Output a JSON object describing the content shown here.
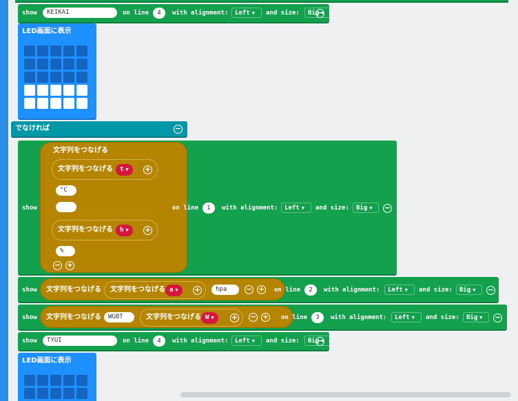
{
  "blocks": {
    "show1": {
      "keyword": "show",
      "text": "KEIKAI",
      "on_line": "on line",
      "line": "4",
      "with_alignment": "with alignment:",
      "alignment": "Left",
      "and_size": "and size:",
      "size": "Big"
    },
    "led1": {
      "label": "LED画面に表示",
      "pattern": [
        0,
        0,
        0,
        0,
        0,
        0,
        0,
        0,
        0,
        0,
        0,
        0,
        0,
        0,
        0,
        1,
        1,
        1,
        1,
        1,
        1,
        1,
        1,
        1,
        1
      ]
    },
    "else": {
      "label": "でなければ"
    },
    "show2": {
      "keyword": "show",
      "join_outer": "文字列をつなげる",
      "join_t": "文字列をつなげる",
      "var_t": "t",
      "str_c": "°C",
      "str_empty": "",
      "join_h": "文字列をつなげる",
      "var_h": "h",
      "str_pct": "%",
      "on_line": "on line",
      "line": "1",
      "with_alignment": "with alignment:",
      "alignment": "Left",
      "and_size": "and size:",
      "size": "Big"
    },
    "show3": {
      "keyword": "show",
      "join_outer": "文字列をつなげる",
      "join_inner": "文字列をつなげる",
      "var": "a",
      "str": "hpa",
      "on_line": "on line",
      "line": "2",
      "with_alignment": "with alignment:",
      "alignment": "Left",
      "and_size": "and size:",
      "size": "Big"
    },
    "show4": {
      "keyword": "show",
      "join_outer": "文字列をつなげる",
      "str": "WGBT",
      "join_inner": "文字列をつなげる",
      "var": "W",
      "on_line": "on line",
      "line": "3",
      "with_alignment": "with alignment:",
      "alignment": "Left",
      "and_size": "and size:",
      "size": "Big"
    },
    "show5": {
      "keyword": "show",
      "text": "TYUI",
      "on_line": "on line",
      "line": "4",
      "with_alignment": "with alignment:",
      "alignment": "Left",
      "and_size": "and size:",
      "size": "Big"
    },
    "led2": {
      "label": "LED画面に表示"
    }
  },
  "icons": {
    "minus": "minus-circle-icon",
    "plus": "plus-circle-icon",
    "caret": "caret-down-icon"
  },
  "colors": {
    "green": "#13a14e",
    "blue": "#1e90ff",
    "teal": "#0097a7",
    "gold": "#b58400",
    "red": "#d6163d"
  }
}
